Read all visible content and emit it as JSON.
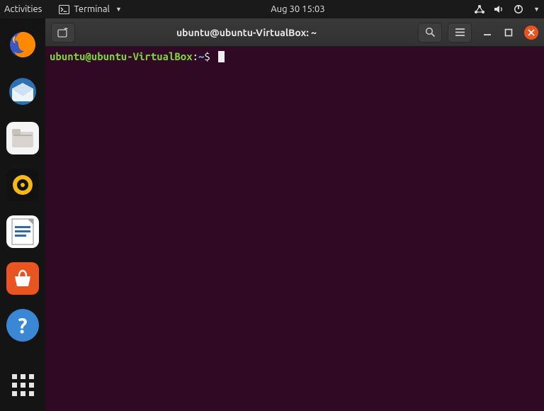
{
  "top_panel": {
    "activities": "Activities",
    "app_menu_label": "Terminal",
    "clock": "Aug 30  15:03"
  },
  "dock": {
    "items": [
      {
        "name": "firefox"
      },
      {
        "name": "thunderbird"
      },
      {
        "name": "files"
      },
      {
        "name": "rhythmbox"
      },
      {
        "name": "libreoffice-writer"
      },
      {
        "name": "ubuntu-software"
      },
      {
        "name": "help"
      }
    ],
    "show_apps_label": "Show Applications"
  },
  "terminal": {
    "window_title": "ubuntu@ubuntu-VirtualBox: ~",
    "prompt_userhost": "ubuntu@ubuntu-VirtualBox",
    "prompt_path": "~",
    "prompt_symbol": "$",
    "command": ""
  }
}
